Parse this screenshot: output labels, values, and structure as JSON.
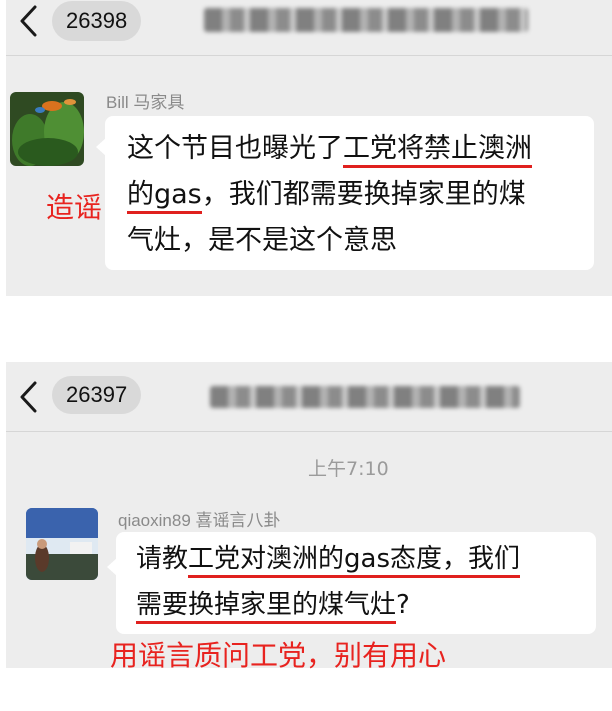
{
  "screenshot_top": {
    "header": {
      "back_icon": "chevron-left-icon",
      "unread_count": "26398",
      "title": ""
    },
    "message": {
      "sender": "Bill 马家具",
      "line1_plain": "这个节目也曝光了",
      "line1_marked": "工党将禁止澳洲",
      "line2_marked": "的gas",
      "line2_plain": "，我们都需要换掉家里的煤",
      "line3_plain": "气灶，是不是这个意思"
    },
    "annotation": "造谣"
  },
  "screenshot_bottom": {
    "header": {
      "back_icon": "chevron-left-icon",
      "unread_count": "26397",
      "title": ""
    },
    "timestamp": "上午7:10",
    "message": {
      "sender": "qiaoxin89 喜谣言八卦",
      "line1_plain": "请教",
      "line1_marked": "工党对澳洲的gas态度，我们",
      "line2_marked": "需要换掉家里的煤气灶",
      "line2_plain": "?"
    },
    "annotation": "用谣言质问工党，别有用心"
  },
  "colors": {
    "annotation": "#e8231f",
    "underline": "#e0201e",
    "chat_background": "#ededed",
    "bubble": "#ffffff",
    "pill": "#d9d9d9"
  }
}
